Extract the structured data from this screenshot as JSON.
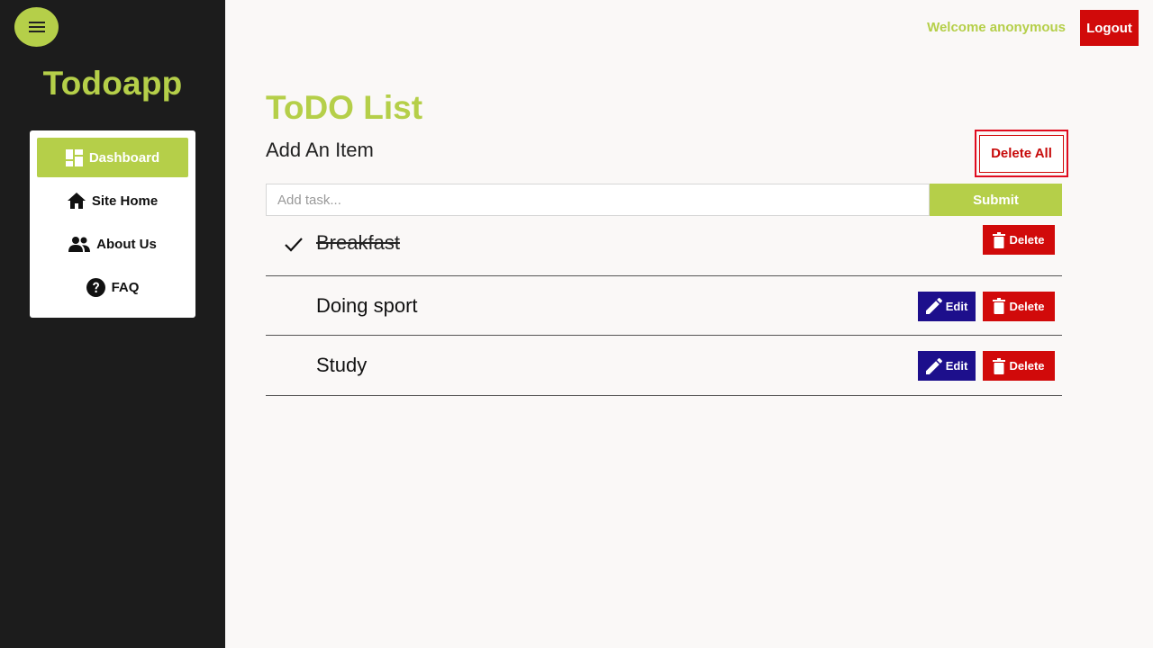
{
  "colors": {
    "accent": "#b5cf49",
    "danger": "#d10a0a",
    "edit": "#1d0f8c",
    "sidebar_bg": "#1c1c1c"
  },
  "sidebar": {
    "menu_icon": "hamburger-icon",
    "brand": "Todoapp",
    "items": [
      {
        "label": "Dashboard",
        "icon": "dashboard-icon",
        "active": true
      },
      {
        "label": "Site Home",
        "icon": "home-icon",
        "active": false
      },
      {
        "label": "About Us",
        "icon": "people-icon",
        "active": false
      },
      {
        "label": "FAQ",
        "icon": "question-circle-icon",
        "active": false
      }
    ]
  },
  "topbar": {
    "welcome": "Welcome anonymous",
    "logout_label": "Logout"
  },
  "main": {
    "title": "ToDO List",
    "add_label": "Add An Item",
    "delete_all_label": "Delete All",
    "input": {
      "placeholder": "Add task...",
      "value": ""
    },
    "submit_label": "Submit",
    "todos": [
      {
        "text": "Breakfast",
        "done": true,
        "edit_label": "",
        "delete_label": "Delete"
      },
      {
        "text": "Doing sport",
        "done": false,
        "edit_label": "Edit",
        "delete_label": "Delete"
      },
      {
        "text": "Study",
        "done": false,
        "edit_label": "Edit",
        "delete_label": "Delete"
      }
    ]
  }
}
